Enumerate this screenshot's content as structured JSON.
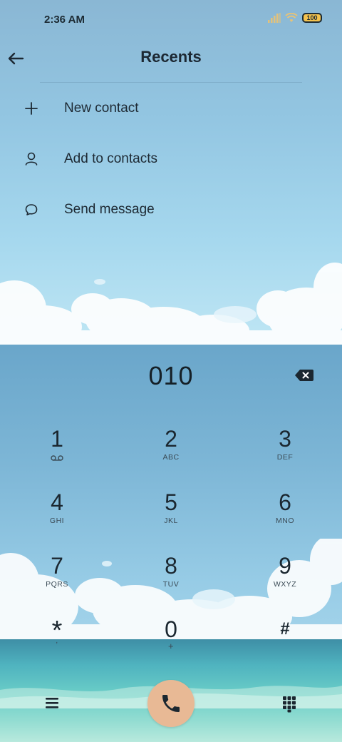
{
  "status_bar": {
    "time": "2:36 AM",
    "battery": "100",
    "icons": [
      "signal-icon",
      "wifi-icon",
      "battery-icon"
    ]
  },
  "header": {
    "title": "Recents",
    "back_icon": "arrow-left-icon"
  },
  "menu": {
    "items": [
      {
        "label": "New contact",
        "icon": "plus-icon"
      },
      {
        "label": "Add to contacts",
        "icon": "person-icon"
      },
      {
        "label": "Send message",
        "icon": "message-bubble-icon"
      }
    ]
  },
  "dialer": {
    "number": "010",
    "backspace_icon": "backspace-icon",
    "keys": [
      {
        "digit": "1",
        "letters": ""
      },
      {
        "digit": "2",
        "letters": "ABC"
      },
      {
        "digit": "3",
        "letters": "DEF"
      },
      {
        "digit": "4",
        "letters": "GHI"
      },
      {
        "digit": "5",
        "letters": "JKL"
      },
      {
        "digit": "6",
        "letters": "MNO"
      },
      {
        "digit": "7",
        "letters": "PQRS"
      },
      {
        "digit": "8",
        "letters": "TUV"
      },
      {
        "digit": "9",
        "letters": "WXYZ"
      },
      {
        "digit": "*",
        "letters": ","
      },
      {
        "digit": "0",
        "letters": "+"
      },
      {
        "digit": "#",
        "letters": ""
      }
    ]
  },
  "bottom_bar": {
    "menu_icon": "hamburger-menu-icon",
    "call_icon": "phone-icon",
    "call_color": "#e8b995",
    "dialpad_icon": "dialpad-icon"
  }
}
